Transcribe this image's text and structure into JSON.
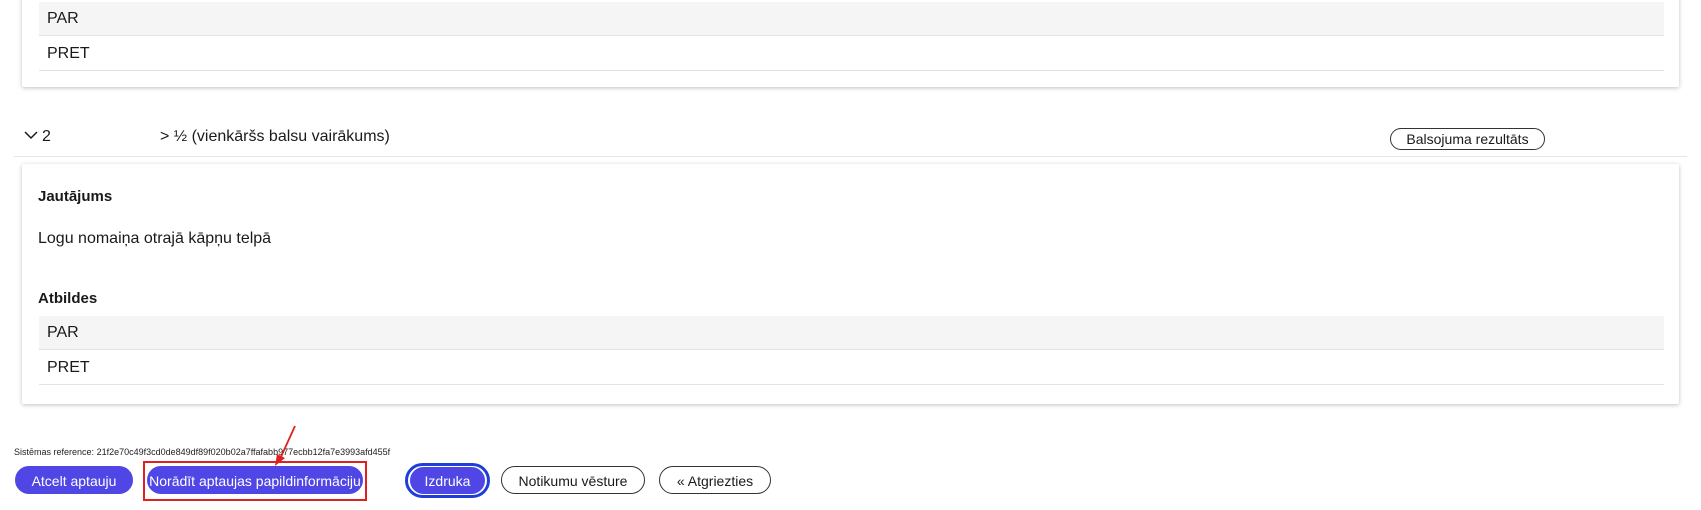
{
  "question1": {
    "answers": [
      "PAR",
      "PRET"
    ]
  },
  "question2": {
    "number": "2",
    "majority": "> ½ (vienkāršs balsu vairākums)",
    "results_button": "Balsojuma rezultāts",
    "question_heading": "Jautājums",
    "question_text": "Logu nomaiņa otrajā kāpņu telpā",
    "answers_heading": "Atbildes",
    "answers": [
      "PAR",
      "PRET"
    ]
  },
  "footer": {
    "system_reference_label": "Sistēmas reference:",
    "system_reference_value": "21f2e70c49f3cd0de849df89f020b02a7ffafabb977ecbb12fa7e3993afd455f",
    "buttons": {
      "cancel": "Atcelt aptauju",
      "additional_info": "Norādīt aptaujas papildinformāciju",
      "print": "Izdruka",
      "history": "Notikumu vēsture",
      "back": "« Atgriezties"
    }
  },
  "colors": {
    "primary": "#4f46e5",
    "focus": "#1d3fd8",
    "annotation": "#e02020"
  }
}
